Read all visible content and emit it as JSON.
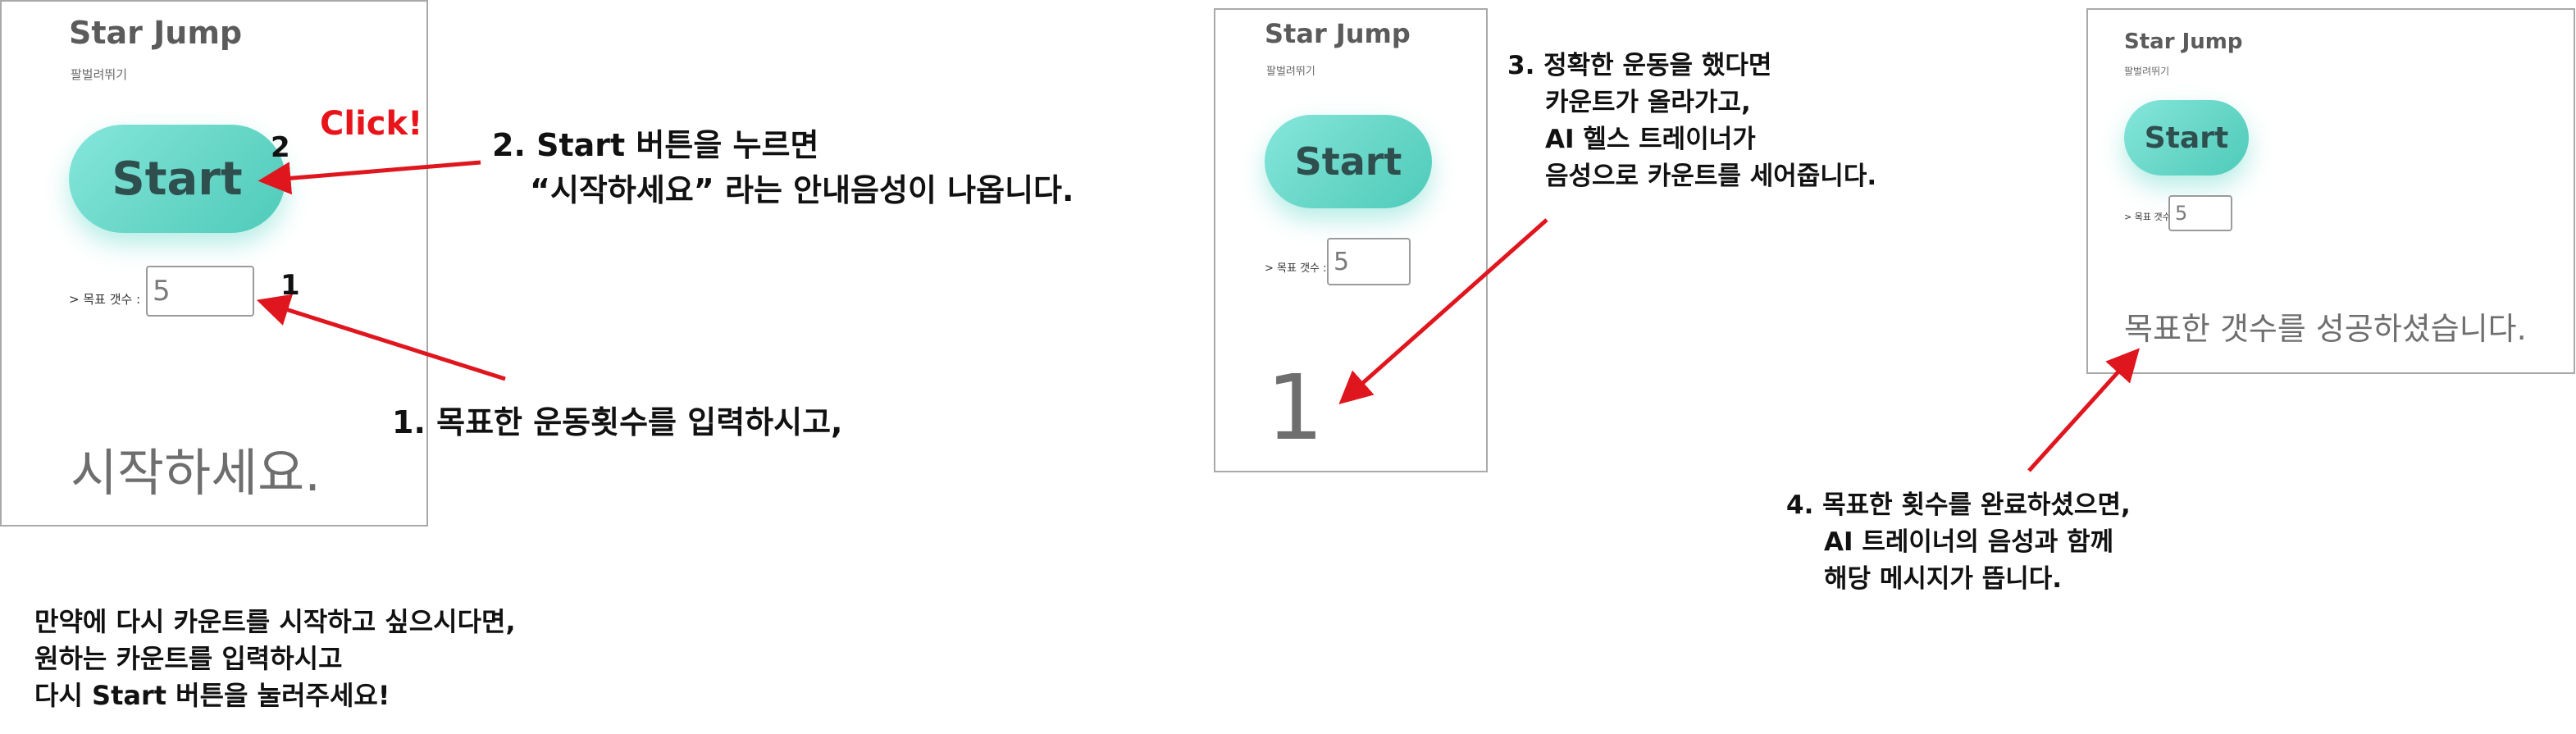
{
  "app": {
    "title": "Star Jump",
    "subtitle": "팔벌려뛰기",
    "start_label": "Start",
    "count_label": "> 목표 갯수 :",
    "count_value": "5"
  },
  "panel1": {
    "status": "시작하세요."
  },
  "panel2": {
    "count": "1"
  },
  "panel3": {
    "status": "목표한 갯수를 성공하셨습니다."
  },
  "callouts": {
    "marker_1": "1",
    "marker_2": "2",
    "click": "Click!"
  },
  "notes": {
    "step1": "1. 목표한 운동횟수를 입력하시고,",
    "step2": [
      "2. Start 버튼을 누르면",
      "“시작하세요” 라는 안내음성이 나옵니다."
    ],
    "step3": [
      "3. 정확한 운동을 했다면",
      "카운트가 올라가고,",
      "AI 헬스 트레이너가",
      "음성으로 카운트를 세어줍니다."
    ],
    "step4": [
      "4. 목표한 횟수를 완료하셨으면,",
      "AI 트레이너의 음성과 함께",
      "해당 메시지가 뜹니다."
    ],
    "restart": [
      "만약에 다시 카운트를 시작하고 싶으시다면,",
      "원하는 카운트를 입력하시고",
      "다시 Start 버튼을 눌러주세요!"
    ]
  },
  "colors": {
    "arrow": "#e0161e",
    "button": "#67d6c7",
    "panel_border": "#a9a9a9"
  }
}
